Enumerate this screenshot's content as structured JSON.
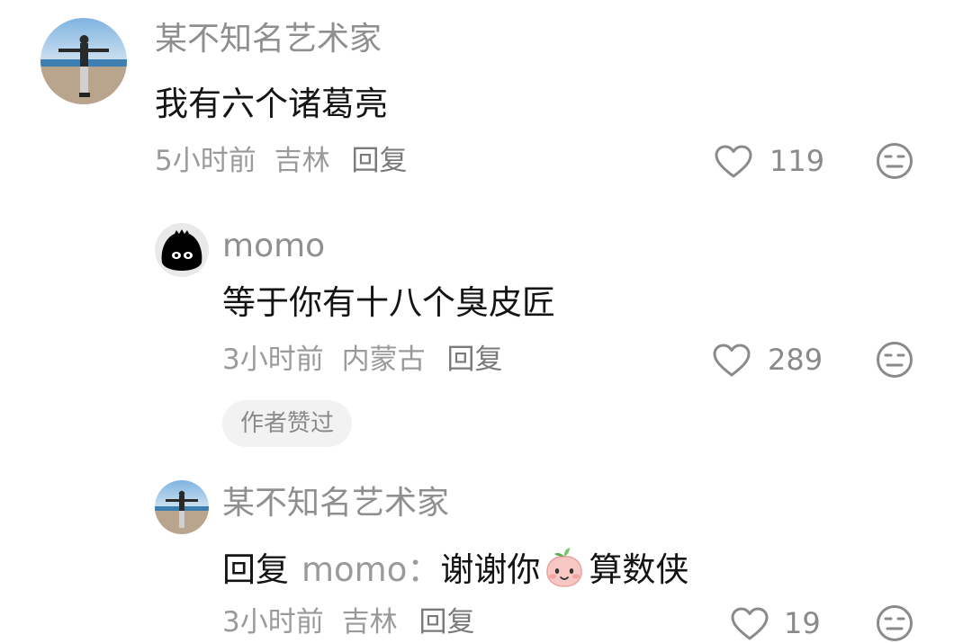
{
  "comments": [
    {
      "username": "某不知名艺术家",
      "text": "我有六个诸葛亮",
      "time": "5小时前",
      "location": "吉林",
      "reply_label": "回复",
      "likes": "119",
      "icon_like": "heart-outline-icon",
      "icon_dislike": "neutral-face-icon"
    },
    {
      "username": "momo",
      "text": "等于你有十八个臭皮匠",
      "time": "3小时前",
      "location": "内蒙古",
      "reply_label": "回复",
      "likes": "289",
      "badge": "作者赞过",
      "icon_like": "heart-outline-icon",
      "icon_dislike": "neutral-face-icon"
    },
    {
      "username": "某不知名艺术家",
      "reply_prefix": "回复",
      "reply_to": "momo：",
      "text_before_emoji": "谢谢你",
      "emoji": "peach-face-emoji",
      "text_after_emoji": "算数侠",
      "time": "3小时前",
      "location": "吉林",
      "reply_label": "回复",
      "likes": "19",
      "icon_like": "heart-outline-icon",
      "icon_dislike": "neutral-face-icon"
    }
  ]
}
